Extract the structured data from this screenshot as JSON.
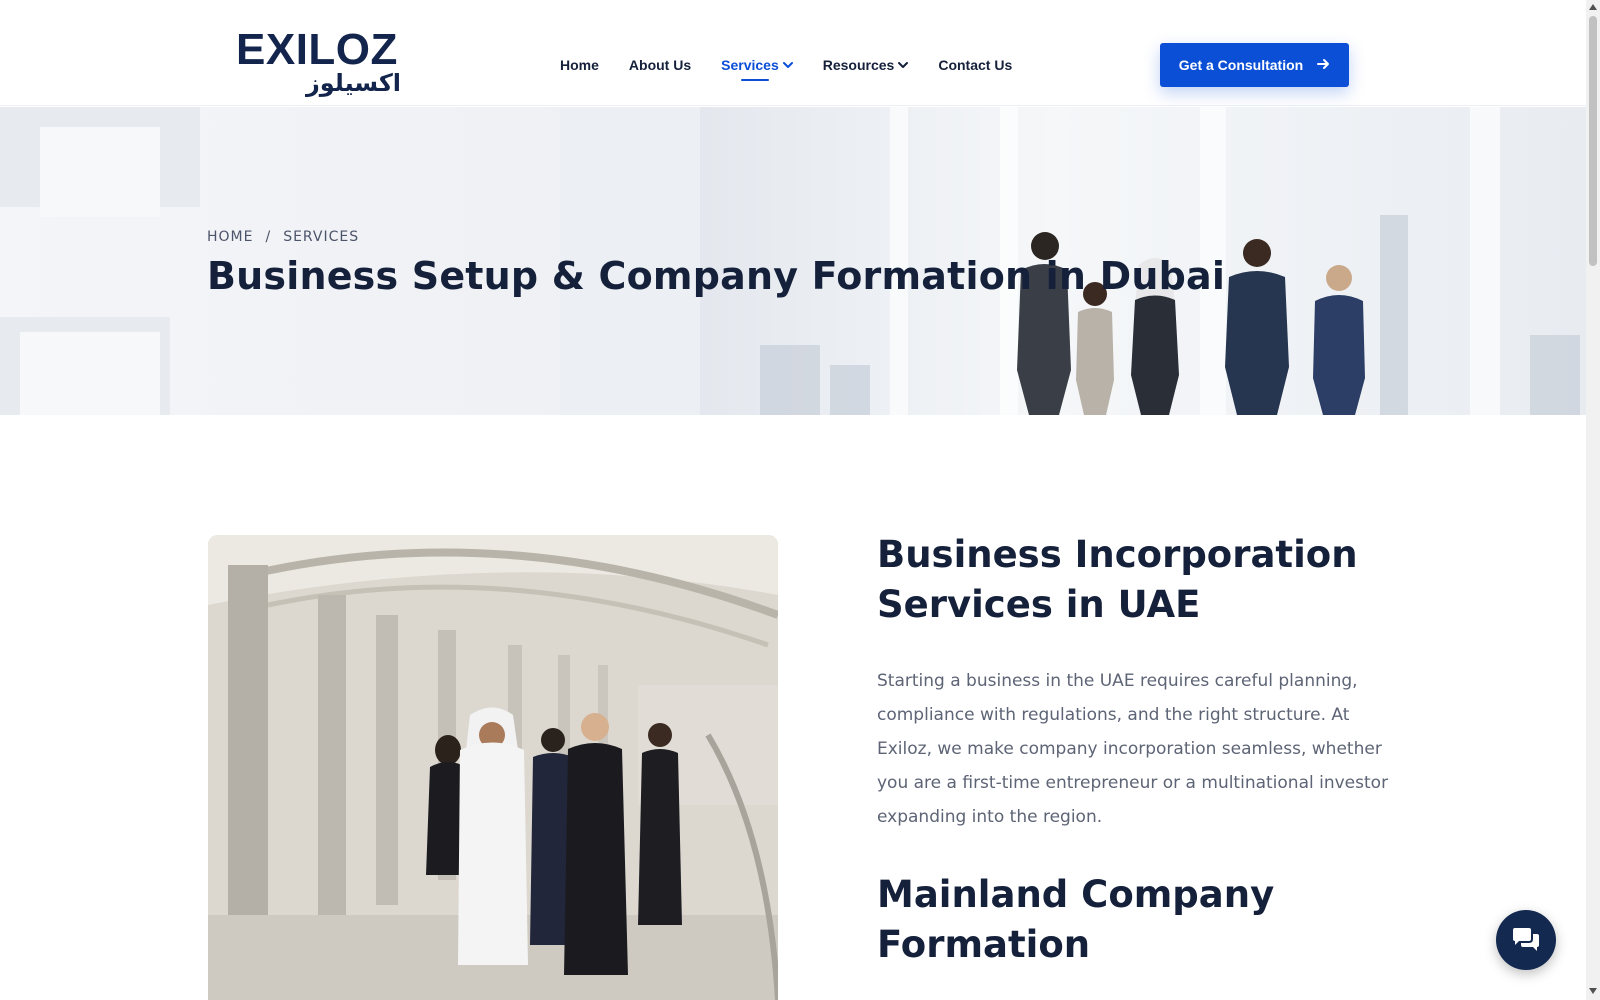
{
  "stray_text": "-->",
  "header": {
    "logo_latin": "EXILOZ",
    "logo_arabic": "اكسيلوز",
    "nav": [
      {
        "label": "Home"
      },
      {
        "label": "About Us"
      },
      {
        "label": "Services",
        "active": true,
        "dropdown": true
      },
      {
        "label": "Resources",
        "dropdown": true
      },
      {
        "label": "Contact Us"
      }
    ],
    "cta_label": "Get a Consultation"
  },
  "hero": {
    "breadcrumb": [
      "HOME",
      "SERVICES"
    ],
    "breadcrumb_sep": "/",
    "title": "Business Setup & Company Formation in Dubai"
  },
  "content": {
    "heading1": "Business Incorporation Services in UAE",
    "paragraph1": "Starting a business in the UAE requires careful planning, compliance with regulations, and the right structure. At Exiloz, we make company incorporation seamless, whether you are a first-time entrepreneur or a multinational investor expanding into the region.",
    "heading2": "Mainland Company Formation"
  },
  "colors": {
    "accent": "#0b4fd6",
    "navy": "#13294f",
    "text": "#15203a",
    "muted": "#5d6475"
  },
  "icons": {
    "dropdown": "chevron-down-icon",
    "cta": "arrow-right-icon",
    "chat": "chat-bubbles-icon"
  }
}
